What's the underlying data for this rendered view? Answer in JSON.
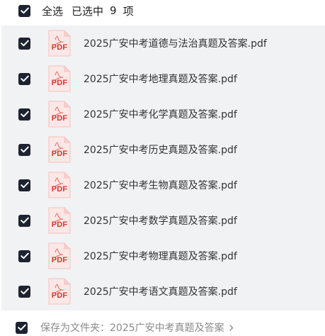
{
  "header": {
    "select_all_label": "全选",
    "selected_prefix": "已选中",
    "selected_count": "9",
    "selected_suffix": "项"
  },
  "files": [
    {
      "name": "2025广安中考道德与法治真题及答案.pdf",
      "icon_text": "PDF"
    },
    {
      "name": "2025广安中考地理真题及答案.pdf",
      "icon_text": "PDF"
    },
    {
      "name": "2025广安中考化学真题及答案.pdf",
      "icon_text": "PDF"
    },
    {
      "name": "2025广安中考历史真题及答案.pdf",
      "icon_text": "PDF"
    },
    {
      "name": "2025广安中考生物真题及答案.pdf",
      "icon_text": "PDF"
    },
    {
      "name": "2025广安中考数学真题及答案.pdf",
      "icon_text": "PDF"
    },
    {
      "name": "2025广安中考物理真题及答案.pdf",
      "icon_text": "PDF"
    },
    {
      "name": "2025广安中考语文真题及答案.pdf",
      "icon_text": "PDF"
    }
  ],
  "footer": {
    "save_label": "保存为文件夹：",
    "folder_name": "2025广安中考真题及答案"
  },
  "icons": {
    "checkbox": "checkbox-checked-icon",
    "file": "pdf-file-icon",
    "chevron": "chevron-right-icon"
  },
  "colors": {
    "checkbox_fill": "#1d2330",
    "list_background": "#f1f2f4",
    "pdf_red": "#d9362b",
    "muted_text": "#8a8a8a"
  }
}
